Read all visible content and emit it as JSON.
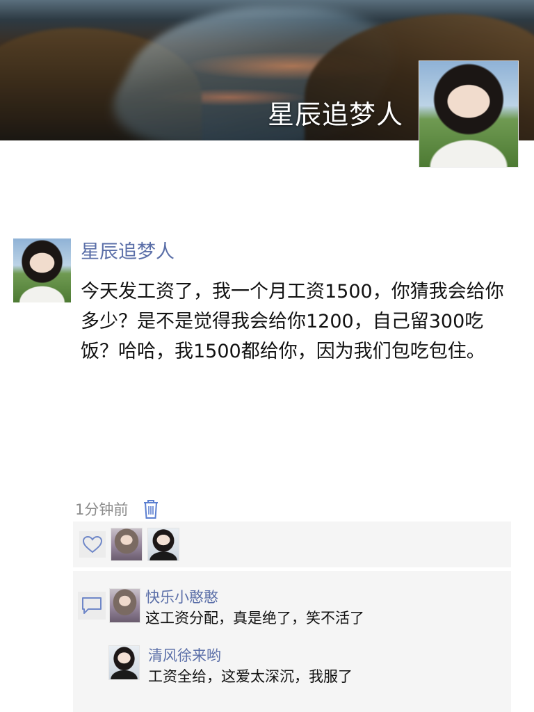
{
  "profile": {
    "display_name": "星辰追梦人"
  },
  "post": {
    "author": "星辰追梦人",
    "text": "今天发工资了，我一个月工资1500，你猜我会给你多少？是不是觉得我会给你1200，自己留300吃饭？哈哈，我1500都给你，因为我们包吃包住。",
    "time": "1分钟前"
  },
  "likes": {
    "icon": "heart-icon",
    "users_count": 2
  },
  "comments": [
    {
      "name": "快乐小憨憨",
      "text": "这工资分配，真是绝了，笑不活了"
    },
    {
      "name": "清风徐来哟",
      "text": "工资全给，这爱太深沉，我服了"
    }
  ],
  "colors": {
    "link_blue": "#5b6fa8",
    "panel_bg": "#f5f5f5",
    "time_gray": "#8a8a8a"
  }
}
